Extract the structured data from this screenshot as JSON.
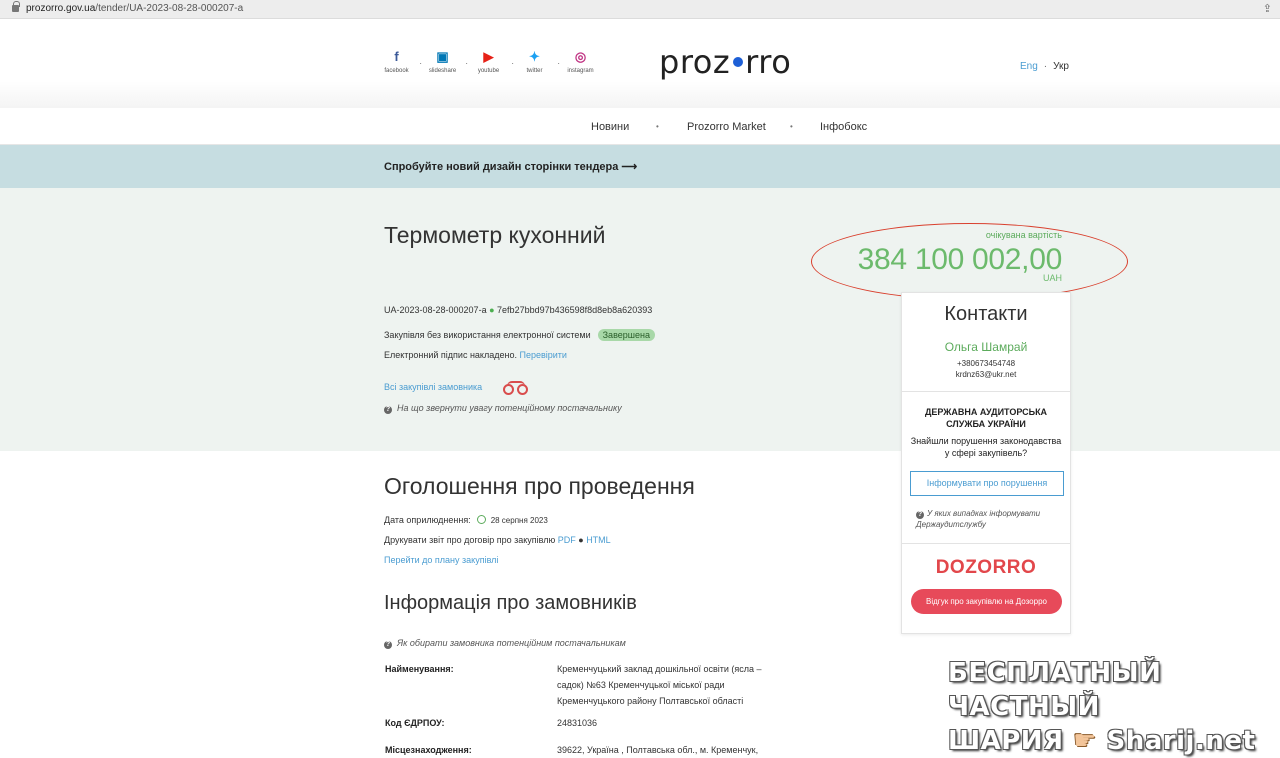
{
  "browser": {
    "url_domain": "prozorro.gov.ua",
    "url_path": "/tender/UA-2023-08-28-000207-a"
  },
  "social": [
    {
      "label": "facebook",
      "icon": "facebook-icon"
    },
    {
      "label": "slideshare",
      "icon": "slideshare-icon"
    },
    {
      "label": "youtube",
      "icon": "youtube-icon"
    },
    {
      "label": "twitter",
      "icon": "twitter-icon"
    },
    {
      "label": "instagram",
      "icon": "instagram-icon"
    }
  ],
  "logo": {
    "left": "proz",
    "right": "rro"
  },
  "lang": {
    "eng": "Eng",
    "ukr": "Укр"
  },
  "nav": [
    "Новини",
    "Prozorro Market",
    "Інфобокс"
  ],
  "banner": {
    "text": "Спробуйте новий дизайн сторінки тендера ⟶"
  },
  "tender": {
    "title": "Термометр кухонний",
    "price_label": "очікувана вартість",
    "price": "384 100 002,00",
    "currency": "UAH",
    "id": "UA-2023-08-28-000207-a",
    "hash": "7efb27bbd97b436598f8d8eb8a620393",
    "procedure": "Закупівля без використання електронної системи",
    "status": "Завершена",
    "signature_text": "Електронний підпис накладено.",
    "signature_link": "Перевірити",
    "all_procurements": "Всі закупівлі замовника",
    "hint": "На що звернути увагу потенційному постачальнику"
  },
  "contacts": {
    "title": "Контакти",
    "name": "Ольга Шамрай",
    "phone": "+380673454748",
    "email": "krdnz63@ukr.net",
    "dasu": "ДЕРЖАВНА АУДИТОРСЬКА СЛУЖБА УКРАЇНИ",
    "found": "Знайшли порушення законодавства у сфері закупівель?",
    "inform_button": "Інформувати про порушення",
    "inform_hint": "У яких випадках інформувати Держаудитслужбу",
    "dozorro": "DOZORRO",
    "dozorro_button": "Відгук про закупівлю на Дозорро"
  },
  "announcement": {
    "title": "Оголошення про проведення",
    "pub_label": "Дата оприлюднення:",
    "pub_date": "28 серпня 2023",
    "print_label": "Друкувати звіт про договір про закупівлю",
    "pdf": "PDF",
    "html": "HTML",
    "plan_link": "Перейти до плану закупівлі"
  },
  "customer": {
    "title": "Інформація про замовників",
    "hint": "Як обирати замовника потенційним постачальникам",
    "rows": [
      {
        "label": "Найменування:",
        "value": "Кременчуцький заклад дошкільної освіти (ясла – садок) №63 Кременчуцької міської ради Кременчуцького району Полтавської області"
      },
      {
        "label": "Код ЄДРПОУ:",
        "value": "24831036"
      },
      {
        "label": "Місцезнаходження:",
        "value": "39622, Україна , Полтавська обл., м. Кременчук,"
      }
    ]
  },
  "watermark": {
    "line1": "БЕСПЛАТНЫЙ ЧАСТНЫЙ",
    "line2a": "ШАРИЯ",
    "line2b": "Sharij.net"
  }
}
